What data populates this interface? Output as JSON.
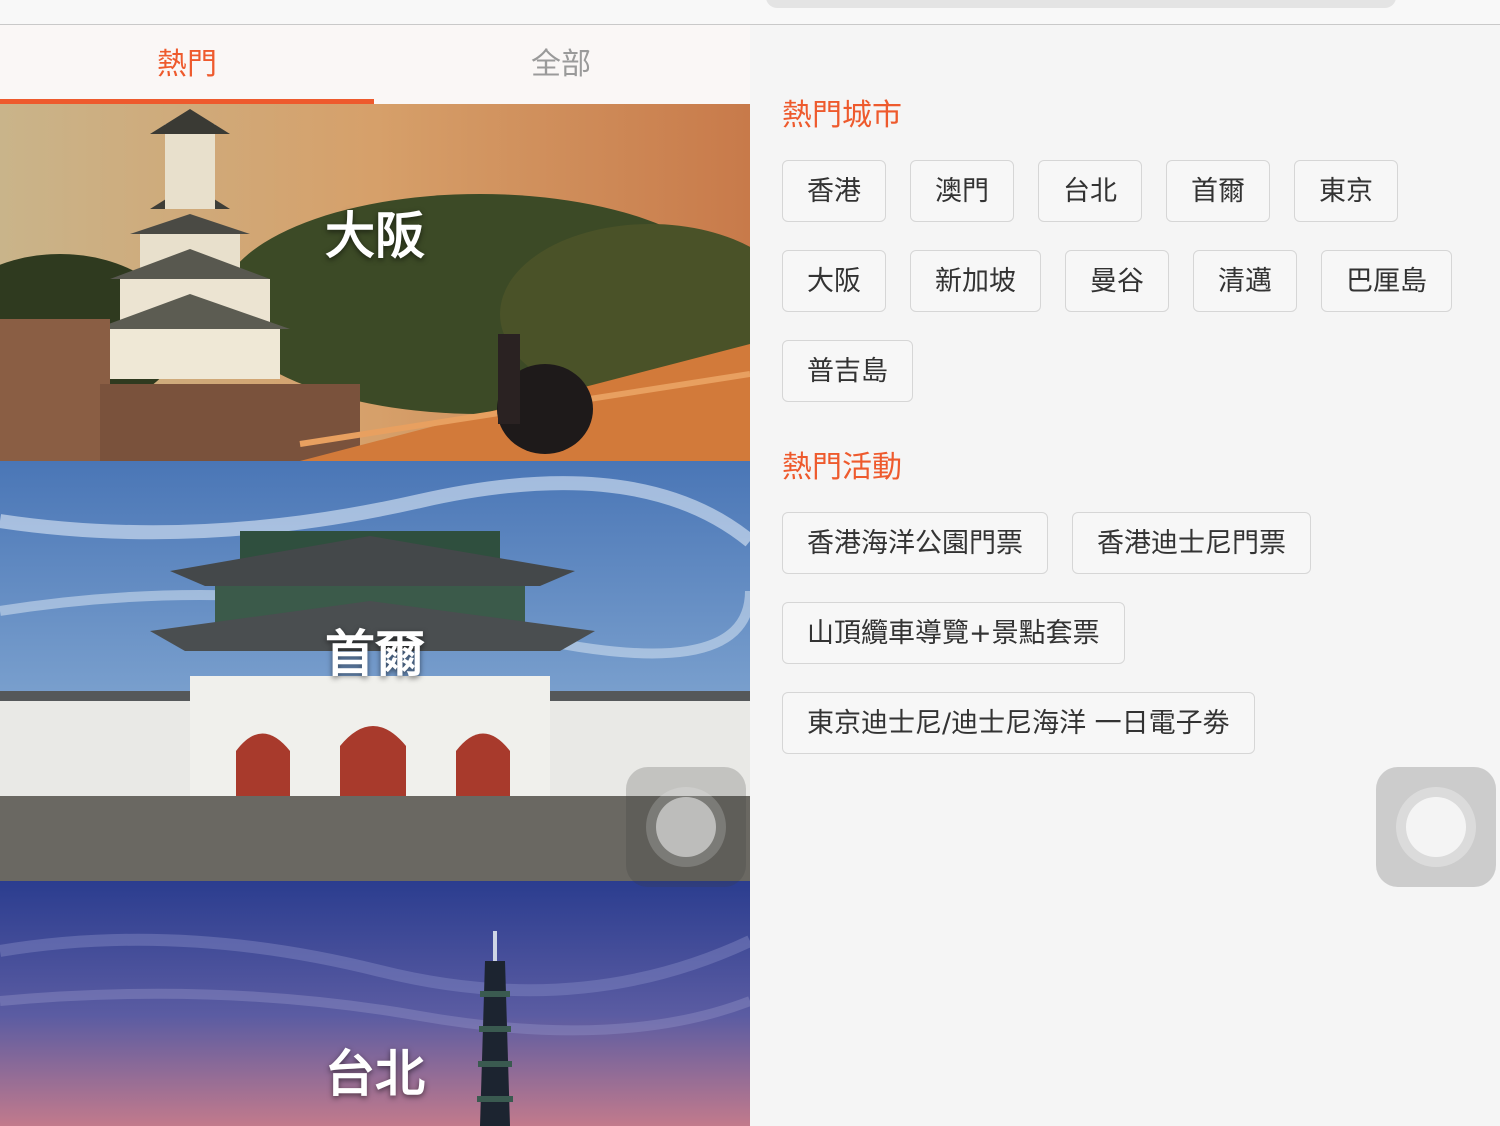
{
  "tabs": {
    "popular": "熱門",
    "all": "全部"
  },
  "cards": [
    {
      "title": "大阪"
    },
    {
      "title": "首爾"
    },
    {
      "title": "台北"
    }
  ],
  "hot_cities": {
    "title": "熱門城市",
    "items": [
      "香港",
      "澳門",
      "台北",
      "首爾",
      "東京",
      "大阪",
      "新加坡",
      "曼谷",
      "清邁",
      "巴厘島",
      "普吉島"
    ]
  },
  "hot_activities": {
    "title": "熱門活動",
    "items": [
      "香港海洋公園門票",
      "香港迪士尼門票",
      "山頂纜車導覽+景點套票",
      "東京迪士尼/迪士尼海洋 一日電子劵"
    ]
  },
  "colors": {
    "accent": "#ee5a2d",
    "background": "#f5f5f5"
  }
}
